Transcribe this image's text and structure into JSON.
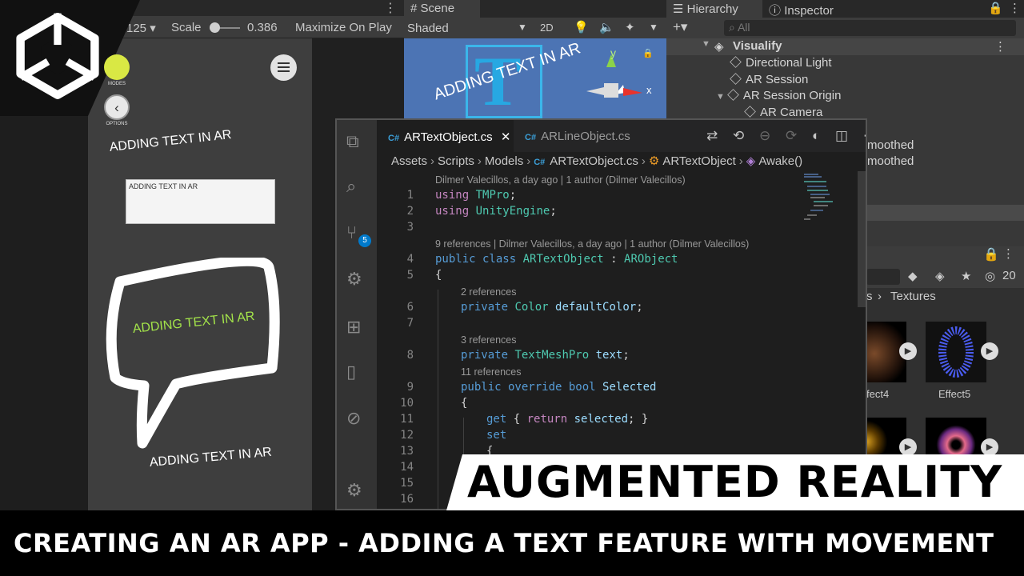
{
  "video": {
    "title": "AUGMENTED REALITY",
    "subtitle": "CREATING AN AR APP - ADDING A TEXT FEATURE WITH MOVEMENT"
  },
  "game_view": {
    "aspect_partial": "125",
    "scale_label": "Scale",
    "scale_value": "0.386",
    "maximize_label": "Maximize On Play",
    "modes_label": "MODES",
    "options_label": "OPTIONS",
    "ar_text_1": "ADDING TEXT IN AR",
    "input_value": "ADDING TEXT IN AR",
    "bubble_text": "ADDING TEXT IN AR",
    "ar_text_3": "ADDING TEXT IN AR"
  },
  "scene_view": {
    "tab": "Scene",
    "draw_mode": "Shaded",
    "mode_2d": "2D",
    "scene_text": "ADDING TEXT IN AR",
    "gizmo_y": "y",
    "gizmo_x": "x",
    "t_glyph": "T"
  },
  "hierarchy": {
    "tab": "Hierarchy",
    "inspector_tab": "Inspector",
    "search_placeholder": "All",
    "scene_name": "Visualify",
    "items": [
      "Directional Light",
      "AR Session",
      "AR Session Origin",
      "AR Camera"
    ],
    "partial_1": "moothed",
    "partial_2": "moothed"
  },
  "project": {
    "count": "20",
    "crumb_partial": "s",
    "folder": "Textures",
    "assets": [
      "fect4",
      "Effect5"
    ]
  },
  "vscode": {
    "tabs": [
      {
        "label": "ARTextObject.cs"
      },
      {
        "label": "ARLineObject.cs"
      }
    ],
    "breadcrumb": [
      "Assets",
      "Scripts",
      "Models",
      "ARTextObject.cs",
      "ARTextObject",
      "Awake()"
    ],
    "scm_badge": "5",
    "lens": {
      "file_blame": "Dilmer Valecillos, a day ago | 1 author (Dilmer Valecillos)",
      "class_refs": "9 references | Dilmer Valecillos, a day ago | 1 author (Dilmer Valecillos)",
      "color_refs": "2 references",
      "text_refs": "3 references",
      "selected_refs": "11 references"
    },
    "line_numbers": [
      "1",
      "2",
      "3",
      "4",
      "5",
      "6",
      "7",
      "8",
      "9",
      "10",
      "11",
      "12",
      "13",
      "14",
      "15",
      "16"
    ],
    "code": {
      "l1": {
        "kw": "using",
        "ns": "TMPro",
        "end": ";"
      },
      "l2": {
        "kw": "using",
        "ns": "UnityEngine",
        "end": ";"
      },
      "l4": {
        "kw": "public class",
        "name": "ARTextObject",
        "colon": " : ",
        "base": "ARObject"
      },
      "l5": "{",
      "l6": {
        "kw": "private",
        "type": "Color",
        "name": "defaultColor",
        "end": ";"
      },
      "l8": {
        "kw": "private",
        "type": "TextMeshPro",
        "name": "text",
        "end": ";"
      },
      "l9": {
        "kw": "public override bool",
        "name": "Selected"
      },
      "l10": "{",
      "l11": {
        "kw": "get",
        "open": " { ",
        "ret": "return",
        "name": "selected",
        "end": "; }"
      },
      "l12": {
        "kw": "set"
      },
      "l13": "{"
    }
  }
}
